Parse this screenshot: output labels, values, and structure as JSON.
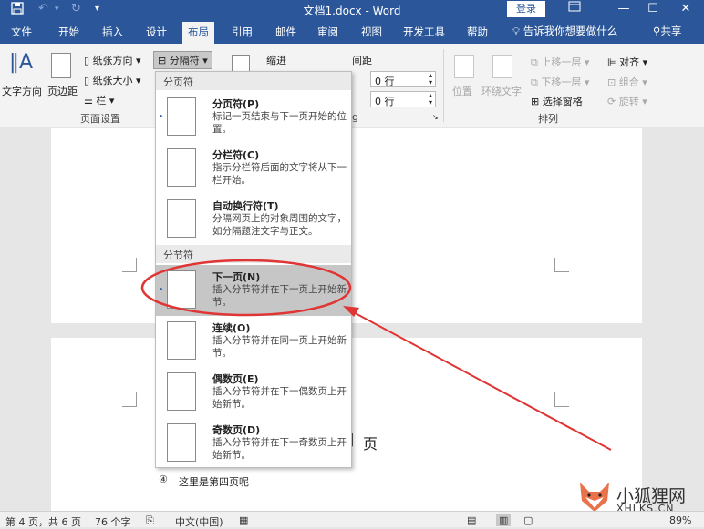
{
  "titlebar": {
    "title": "文档1.docx - Word",
    "login": "登录",
    "save_icon": "save-icon",
    "colors": {
      "bar": "#2b579a"
    }
  },
  "tabs": [
    {
      "label": "文件",
      "active": false
    },
    {
      "label": "开始",
      "active": false
    },
    {
      "label": "插入",
      "active": false
    },
    {
      "label": "设计",
      "active": false
    },
    {
      "label": "布局",
      "active": true
    },
    {
      "label": "引用",
      "active": false
    },
    {
      "label": "邮件",
      "active": false
    },
    {
      "label": "审阅",
      "active": false
    },
    {
      "label": "视图",
      "active": false
    },
    {
      "label": "开发工具",
      "active": false
    },
    {
      "label": "帮助",
      "active": false
    }
  ],
  "tellme": "告诉我你想要做什么",
  "share": "共享",
  "ribbon": {
    "text_direction": "文字方向",
    "margins": "页边距",
    "orientation": "纸张方向",
    "size": "纸张大小",
    "columns": "栏",
    "breaks": "分隔符",
    "page_setup_group": "页面设置",
    "indent": "缩进",
    "spacing": "间距",
    "spacing_before": "0 行",
    "spacing_after": "0 行",
    "paragraph_group_suffix": "g",
    "position": "位置",
    "wrap_text": "环绕文字",
    "bring_forward": "上移一层",
    "send_backward": "下移一层",
    "selection_pane": "选择窗格",
    "align": "对齐",
    "group": "组合",
    "rotate": "旋转",
    "arrange_group": "排列"
  },
  "breaks_menu": {
    "page_breaks_header": "分页符",
    "section_breaks_header": "分节符",
    "items": [
      {
        "title": "分页符(P)",
        "desc": "标记一页结束与下一页开始的位置。"
      },
      {
        "title": "分栏符(C)",
        "desc": "指示分栏符后面的文字将从下一栏开始。"
      },
      {
        "title": "自动换行符(T)",
        "desc": "分隔网页上的对象周围的文字，如分隔题注文字与正文。"
      },
      {
        "title": "下一页(N)",
        "desc": "插入分节符并在下一页上开始新节。",
        "highlighted": true
      },
      {
        "title": "连续(O)",
        "desc": "插入分节符并在同一页上开始新节。"
      },
      {
        "title": "偶数页(E)",
        "desc": "插入分节符并在下一偶数页上开始新节。"
      },
      {
        "title": "奇数页(D)",
        "desc": "插入分节符并在下一奇数页上开始新节。"
      }
    ]
  },
  "document": {
    "page_text": "页",
    "list_number": "④",
    "list_text": "这里是第四页呢"
  },
  "statusbar": {
    "page_info": "第 4 页，共 6 页",
    "word_count": "76 个字",
    "language": "中文(中国)",
    "zoom": "89%"
  },
  "watermark": {
    "name": "小狐狸网",
    "domain": "XHLKS.CN"
  },
  "annotation": {
    "color": "#e03535"
  }
}
